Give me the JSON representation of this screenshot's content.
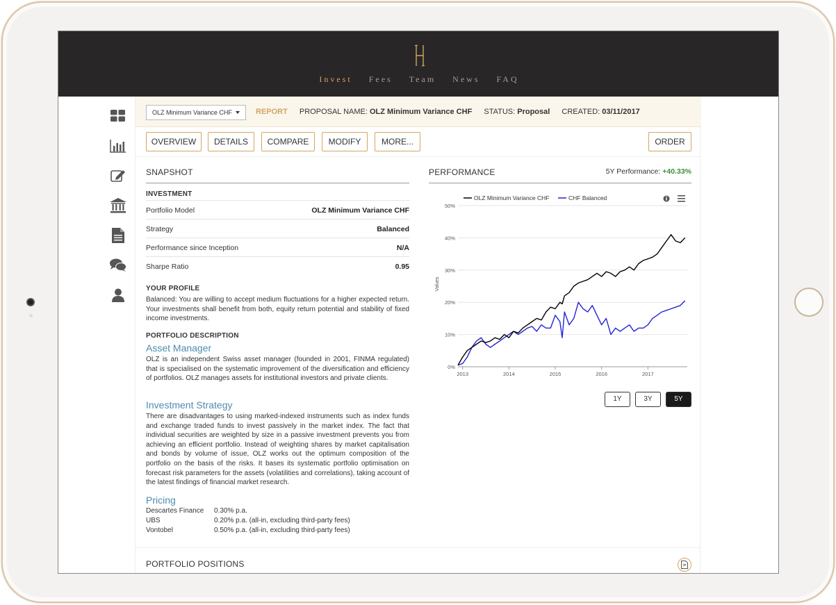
{
  "nav": {
    "items": [
      "Invest",
      "Fees",
      "Team",
      "News",
      "FAQ"
    ],
    "active": "Invest"
  },
  "sidebar": {
    "icons": [
      "dashboard-icon",
      "bar-chart-icon",
      "edit-icon",
      "bank-icon",
      "document-icon",
      "chat-icon",
      "user-icon"
    ]
  },
  "proposal": {
    "select_value": "OLZ Minimum Variance CHF",
    "report_label": "REPORT",
    "name_label": "PROPOSAL NAME:",
    "name_value": "OLZ Minimum Variance CHF",
    "status_label": "STATUS:",
    "status_value": "Proposal",
    "created_label": "CREATED:",
    "created_value": "03/11/2017"
  },
  "tabs": {
    "overview": "OVERVIEW",
    "details": "DETAILS",
    "compare": "COMPARE",
    "modify": "MODIFY",
    "more": "MORE...",
    "order": "ORDER"
  },
  "snapshot": {
    "title": "SNAPSHOT",
    "investment_heading": "INVESTMENT",
    "rows": [
      {
        "label": "Portfolio Model",
        "value": "OLZ Minimum Variance CHF"
      },
      {
        "label": "Strategy",
        "value": "Balanced"
      },
      {
        "label": "Performance since Inception",
        "value": "N/A"
      },
      {
        "label": "Sharpe Ratio",
        "value": "0.95"
      }
    ],
    "profile_heading": "YOUR PROFILE",
    "profile_text": "Balanced: You are willing to accept medium fluctuations for a higher expected return. Your investments shall benefit from both, equity return potential and stability of fixed income investments.",
    "description_heading": "PORTFOLIO DESCRIPTION",
    "asset_manager_title": "Asset Manager",
    "asset_manager_text": "OLZ is an independent Swiss asset manager (founded in 2001, FINMA regulated) that is specialised on the systematic improvement of the diversification and efficiency of portfolios. OLZ manages assets for institutional investors and private clients.",
    "strategy_title": "Investment Strategy",
    "strategy_text": "There are disadvantages to using marked-indexed instruments such as index funds and exchange traded funds to invest passively in the market index. The fact that individual securities are weighted by size in a passive investment prevents you from achieving an efficient portfolio. Instead of weighting shares by market capitalisation and bonds by volume of issue, OLZ works out the optimum composition of the portfolio on the basis of the risks. It bases its systematic portfolio optimisation on forecast risk parameters for the assets (volatilities and correlations), taking account of the latest findings of financial market research.",
    "pricing_title": "Pricing",
    "pricing": [
      {
        "provider": "Descartes Finance",
        "fee": "0.30% p.a."
      },
      {
        "provider": "UBS",
        "fee": "0.20% p.a. (all-in, excluding third-party fees)"
      },
      {
        "provider": "Vontobel",
        "fee": "0.50% p.a. (all-in, excluding third-party fees)"
      }
    ]
  },
  "performance": {
    "title": "PERFORMANCE",
    "five_year_label": "5Y Performance:",
    "five_year_value": "+40.33%",
    "ranges": [
      "1Y",
      "3Y",
      "5Y"
    ],
    "active_range": "5Y"
  },
  "positions": {
    "title": "PORTFOLIO POSITIONS"
  },
  "colors": {
    "accent": "#d3a561",
    "teal": "#4e8cae",
    "positive": "#3b8f3b",
    "series1": "#000000",
    "series2": "#2323d6"
  },
  "chart_data": {
    "type": "line",
    "ylabel": "Values",
    "ylim": [
      0,
      50
    ],
    "yticks": [
      "0%",
      "10%",
      "20%",
      "30%",
      "40%",
      "50%"
    ],
    "xticks": [
      "2013",
      "2014",
      "2015",
      "2016",
      "2017"
    ],
    "xlim": [
      2012.9,
      2017.85
    ],
    "series": [
      {
        "name": "OLZ Minimum Variance CHF",
        "color": "#000000",
        "x": [
          2012.9,
          2013.0,
          2013.1,
          2013.2,
          2013.3,
          2013.4,
          2013.5,
          2013.6,
          2013.7,
          2013.8,
          2013.9,
          2014.0,
          2014.1,
          2014.2,
          2014.3,
          2014.4,
          2014.5,
          2014.6,
          2014.7,
          2014.8,
          2014.9,
          2015.0,
          2015.1,
          2015.15,
          2015.2,
          2015.3,
          2015.4,
          2015.5,
          2015.6,
          2015.7,
          2015.8,
          2015.9,
          2016.0,
          2016.1,
          2016.2,
          2016.3,
          2016.4,
          2016.5,
          2016.6,
          2016.7,
          2016.8,
          2016.9,
          2017.0,
          2017.1,
          2017.2,
          2017.3,
          2017.4,
          2017.5,
          2017.6,
          2017.7,
          2017.8
        ],
        "y": [
          0.5,
          3,
          5,
          6,
          7,
          8,
          7.5,
          8,
          9,
          8.5,
          10,
          9,
          11,
          10.5,
          12,
          13,
          14,
          15,
          14.5,
          17,
          18.5,
          18,
          20,
          19.5,
          22,
          23,
          25,
          26,
          26.5,
          27,
          28,
          29,
          28,
          29.5,
          29,
          28,
          29.5,
          30,
          31,
          30,
          32,
          33,
          33.5,
          34,
          35,
          37,
          39,
          41,
          39,
          38.5,
          40
        ]
      },
      {
        "name": "CHF Balanced",
        "color": "#2323d6",
        "x": [
          2012.9,
          2013.0,
          2013.1,
          2013.2,
          2013.3,
          2013.4,
          2013.5,
          2013.6,
          2013.7,
          2013.8,
          2013.9,
          2014.0,
          2014.1,
          2014.2,
          2014.3,
          2014.4,
          2014.5,
          2014.6,
          2014.7,
          2014.8,
          2014.9,
          2015.0,
          2015.1,
          2015.15,
          2015.2,
          2015.3,
          2015.4,
          2015.5,
          2015.6,
          2015.7,
          2015.8,
          2015.9,
          2016.0,
          2016.1,
          2016.2,
          2016.3,
          2016.4,
          2016.5,
          2016.6,
          2016.7,
          2016.8,
          2016.9,
          2017.0,
          2017.1,
          2017.2,
          2017.3,
          2017.4,
          2017.5,
          2017.6,
          2017.7,
          2017.8
        ],
        "y": [
          0.5,
          1,
          3,
          6,
          8,
          9,
          7,
          6,
          7,
          8,
          9,
          10,
          11,
          10,
          11,
          12,
          12.5,
          11,
          13,
          12,
          12,
          16,
          14,
          9,
          17,
          13,
          15,
          20,
          18,
          17,
          19,
          16,
          13,
          15,
          10,
          12,
          11,
          12,
          13,
          11,
          12,
          12,
          13,
          15,
          16,
          17,
          17.5,
          18,
          18.5,
          19,
          20.5
        ]
      }
    ]
  }
}
